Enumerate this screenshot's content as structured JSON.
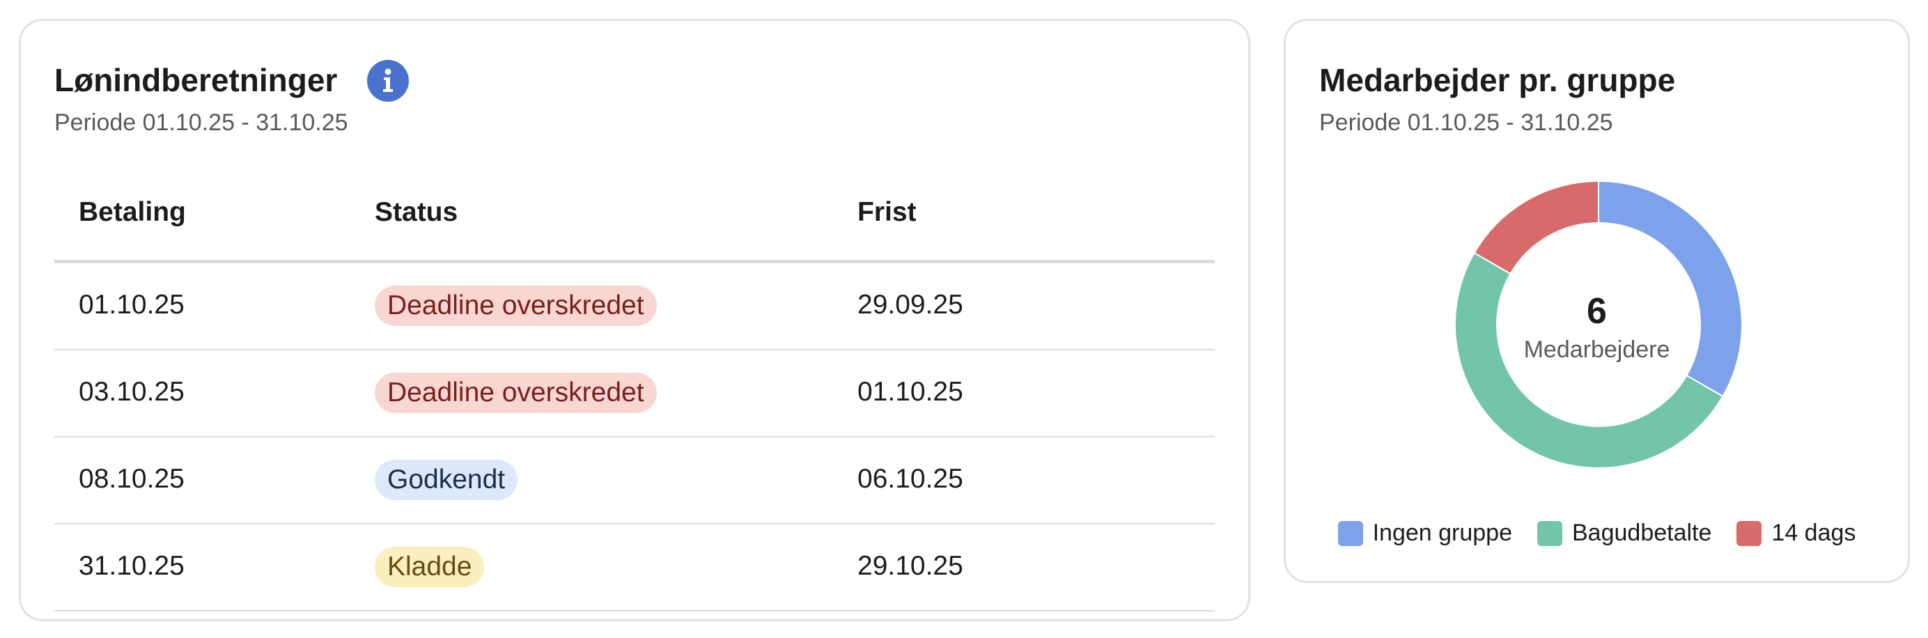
{
  "payroll": {
    "title": "Lønindberetninger",
    "period": "Periode 01.10.25 - 31.10.25",
    "info_icon": "info-icon",
    "columns": [
      "Betaling",
      "Status",
      "Frist"
    ],
    "rows": [
      {
        "payment": "01.10.25",
        "status": "Deadline overskredet",
        "status_type": "error",
        "deadline": "29.09.25"
      },
      {
        "payment": "03.10.25",
        "status": "Deadline overskredet",
        "status_type": "error",
        "deadline": "01.10.25"
      },
      {
        "payment": "08.10.25",
        "status": "Godkendt",
        "status_type": "approved",
        "deadline": "06.10.25"
      },
      {
        "payment": "31.10.25",
        "status": "Kladde",
        "status_type": "draft",
        "deadline": "29.10.25"
      }
    ]
  },
  "groups": {
    "title": "Medarbejder pr. gruppe",
    "period": "Periode 01.10.25 - 31.10.25",
    "total": "6",
    "total_label": "Medarbejdere"
  },
  "chart_data": {
    "type": "pie",
    "variant": "donut",
    "categories": [
      "Ingen gruppe",
      "Bagudbetalte",
      "14 dags"
    ],
    "values": [
      2,
      3,
      1
    ],
    "colors": [
      "#7ea1ec",
      "#72c5aa",
      "#d96a6a"
    ],
    "center_value": "6",
    "center_label": "Medarbejdere",
    "legend": "bottom"
  },
  "colors": {
    "info_icon": "#4a72cc",
    "badge_error_bg": "#f8d7d3",
    "badge_approved_bg": "#dde8fa",
    "badge_draft_bg": "#fbefbf"
  }
}
